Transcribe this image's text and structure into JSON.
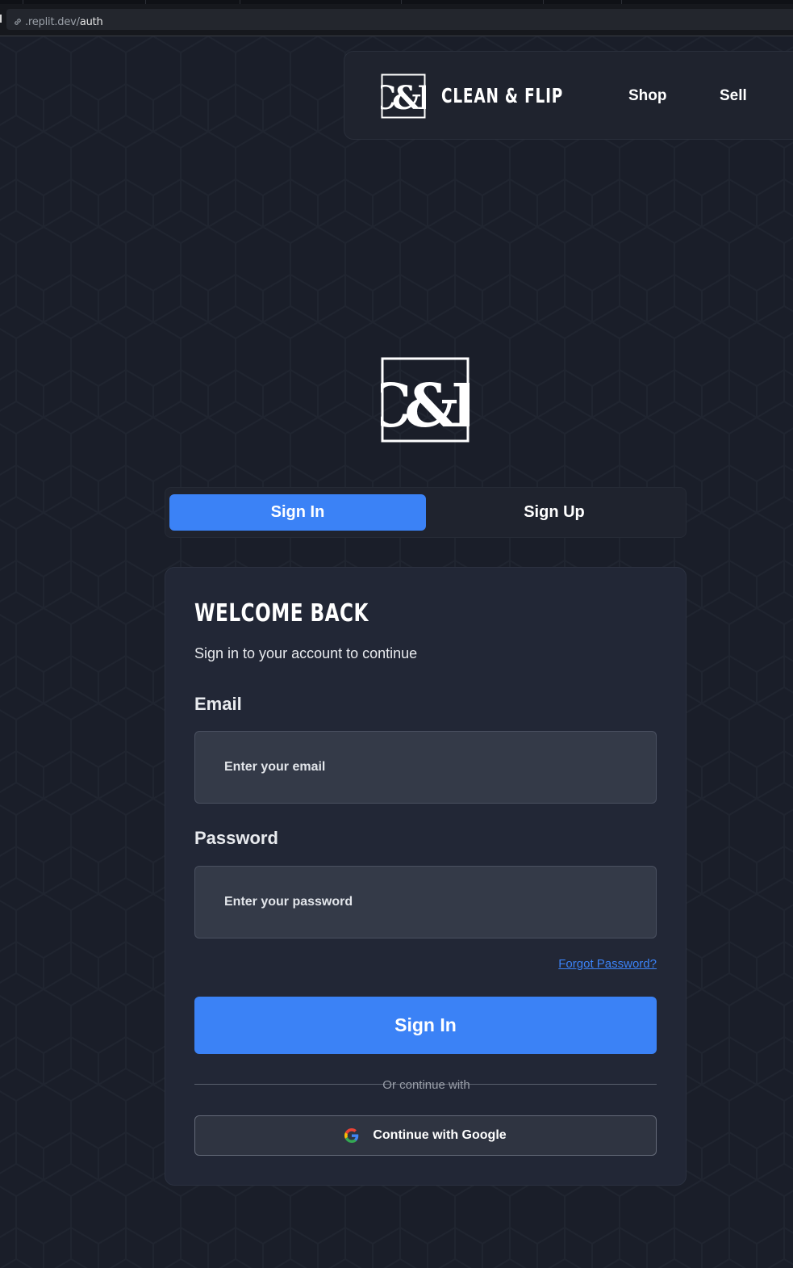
{
  "browser": {
    "url_host": ".replit.dev/",
    "url_path": "auth"
  },
  "header": {
    "logo_text": "C&F",
    "brand": "CLEAN & FLIP",
    "nav": [
      {
        "label": "Shop"
      },
      {
        "label": "Sell"
      }
    ]
  },
  "hero": {
    "logo_text": "C&F"
  },
  "tabs": [
    {
      "label": "Sign In",
      "active": true
    },
    {
      "label": "Sign Up",
      "active": false
    }
  ],
  "form": {
    "title": "WELCOME BACK",
    "subtitle": "Sign in to your account to continue",
    "email": {
      "label": "Email",
      "placeholder": "Enter your email",
      "value": ""
    },
    "password": {
      "label": "Password",
      "placeholder": "Enter your password",
      "value": ""
    },
    "forgot_label": "Forgot Password?",
    "submit_label": "Sign In",
    "divider_label": "Or continue with",
    "google_label": "Continue with Google"
  },
  "colors": {
    "accent": "#3b82f6",
    "background": "#1a1e29",
    "card": "#222736",
    "input": "#343a48"
  },
  "icons": {
    "url": "link-icon",
    "logo": "cf-logo-icon",
    "google": "google-icon"
  }
}
